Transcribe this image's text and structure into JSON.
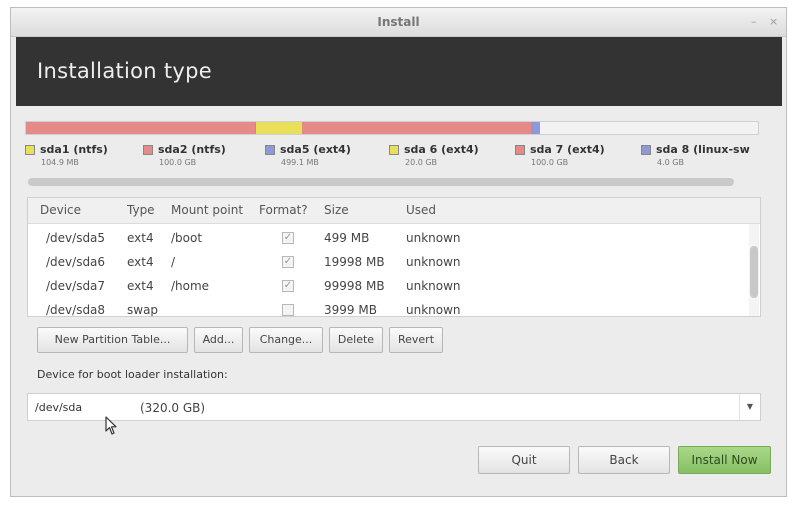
{
  "window": {
    "title": "Install",
    "controls": [
      "–",
      "×"
    ]
  },
  "header": {
    "title": "Installation type"
  },
  "colors": {
    "red": "#e48a8a",
    "yellow": "#e8e05a",
    "blue": "#8e99d6",
    "free": "#f2f2f2",
    "install_green": "#96c872"
  },
  "partition_bar": {
    "segments": [
      {
        "name": "sda1",
        "color": "#e48a8a",
        "fraction": 0.000328
      },
      {
        "name": "sda2",
        "color": "#e48a8a",
        "fraction": 0.3125
      },
      {
        "name": "sda5",
        "color": "#8e99d6",
        "fraction": 0.00156
      },
      {
        "name": "sda6",
        "color": "#e8e05a",
        "fraction": 0.0625
      },
      {
        "name": "sda7",
        "color": "#e48a8a",
        "fraction": 0.3125
      },
      {
        "name": "sda8",
        "color": "#8e99d6",
        "fraction": 0.0125
      },
      {
        "name": "free",
        "color": "#f2f2f2",
        "fraction": 0.2986
      }
    ]
  },
  "legend": [
    {
      "name": "sda1 (ntfs)",
      "size": "104.9 MB",
      "color": "#e8e05a"
    },
    {
      "name": "sda2 (ntfs)",
      "size": "100.0 GB",
      "color": "#e48a8a"
    },
    {
      "name": "sda5 (ext4)",
      "size": "499.1 MB",
      "color": "#8e99d6"
    },
    {
      "name": "sda 6 (ext4)",
      "size": "20.0 GB",
      "color": "#e8e05a"
    },
    {
      "name": "sda 7 (ext4)",
      "size": "100.0 GB",
      "color": "#e48a8a"
    },
    {
      "name": "sda 8 (linux-sw",
      "size": "4.0 GB",
      "color": "#8e99d6"
    }
  ],
  "table": {
    "columns": [
      "Device",
      "Type",
      "Mount point",
      "Format?",
      "Size",
      "Used"
    ],
    "rows": [
      {
        "device": "/dev/sda5",
        "type": "ext4",
        "mount": "/boot",
        "format": true,
        "size": "499 MB",
        "used": "unknown"
      },
      {
        "device": "/dev/sda6",
        "type": "ext4",
        "mount": "/",
        "format": true,
        "size": "19998 MB",
        "used": "unknown"
      },
      {
        "device": "/dev/sda7",
        "type": "ext4",
        "mount": "/home",
        "format": true,
        "size": "99998 MB",
        "used": "unknown"
      },
      {
        "device": "/dev/sda8",
        "type": "swap",
        "mount": "",
        "format": false,
        "size": "3999 MB",
        "used": "unknown"
      }
    ]
  },
  "actions": {
    "new_table": "New Partition Table...",
    "add": "Add...",
    "change": "Change...",
    "delete": "Delete",
    "revert": "Revert"
  },
  "bootloader": {
    "label": "Device for boot loader installation:",
    "device": "/dev/sda",
    "size": "(320.0 GB)"
  },
  "footer": {
    "quit": "Quit",
    "back": "Back",
    "install": "Install Now"
  },
  "icons": {
    "check": "✓",
    "dropdown": "▼"
  }
}
